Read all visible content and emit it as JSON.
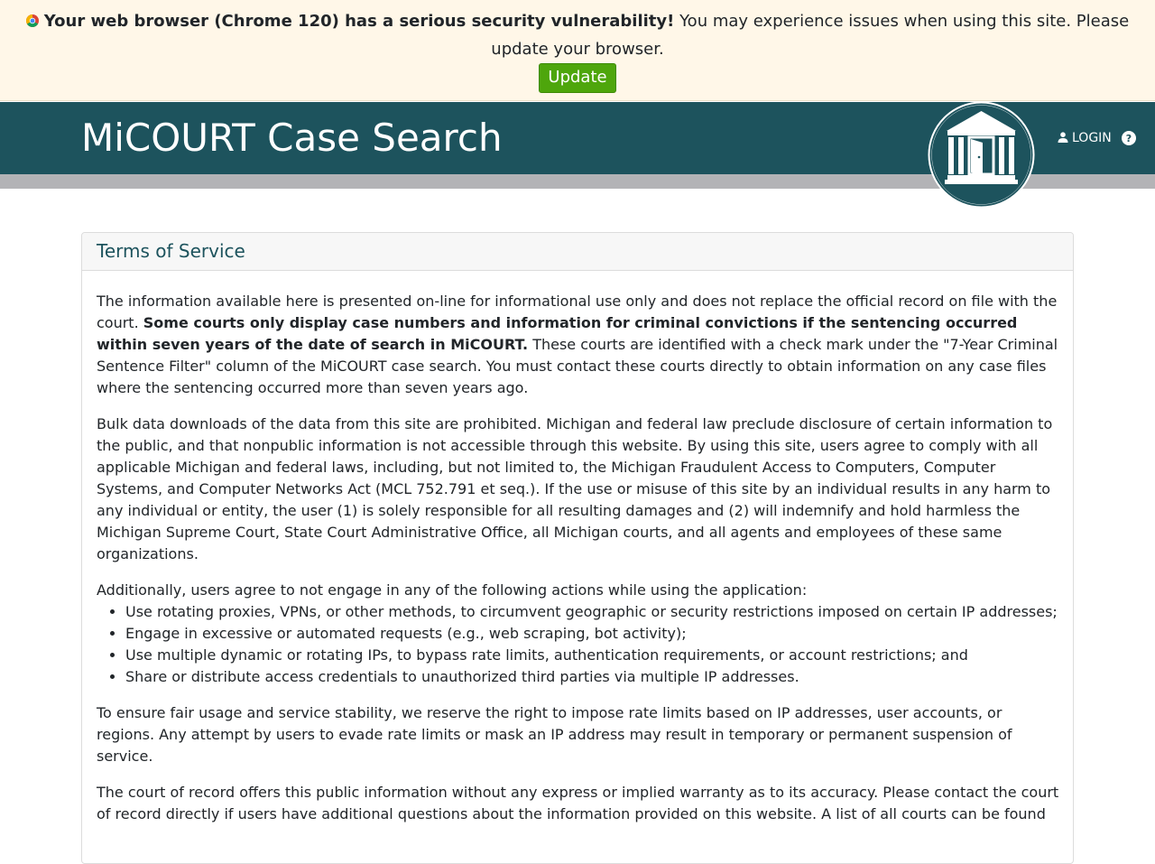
{
  "banner": {
    "warning_bold": "Your web browser (Chrome 120) has a serious security vulnerability!",
    "warning_rest": " You may experience issues when using this site. Please",
    "warning_line2": "update your browser.",
    "update_label": "Update",
    "icon": "chrome-icon"
  },
  "header": {
    "title": "MiCOURT Case Search",
    "login_label": "LOGIN",
    "logo_icon": "courthouse-logo",
    "help_icon": "help-icon",
    "colors": {
      "header_bg": "#1d535d",
      "accent_green": "#4ea60c"
    }
  },
  "terms": {
    "title": "Terms of Service",
    "p1_a": "The information available here is presented on-line for informational use only and does not replace the official record on file with the court. ",
    "p1_bold": "Some courts only display case numbers and information for criminal convictions if the sentencing occurred within seven years of the date of search in MiCOURT.",
    "p1_b": " These courts are identified with a check mark under the \"7-Year Criminal Sentence Filter\" column of the MiCOURT case search. You must contact these courts directly to obtain information on any case files where the sentencing occurred more than seven years ago.",
    "p2": "Bulk data downloads of the data from this site are prohibited. Michigan and federal law preclude disclosure of certain information to the public, and that nonpublic information is not accessible through this website. By using this site, users agree to comply with all applicable Michigan and federal laws, including, but not limited to, the Michigan Fraudulent Access to Computers, Computer Systems, and Computer Networks Act (MCL 752.791 et seq.). If the use or misuse of this site by an individual results in any harm to any individual or entity, the user (1) is solely responsible for all resulting damages and (2) will indemnify and hold harmless the Michigan Supreme Court, State Court Administrative Office, all Michigan courts, and all agents and employees of these same organizations.",
    "p3_intro": "Additionally, users agree to not engage in any of the following actions while using the application:",
    "bullets": [
      "Use rotating proxies, VPNs, or other methods, to circumvent geographic or security restrictions imposed on certain IP addresses;",
      "Engage in excessive or automated requests (e.g., web scraping, bot activity);",
      "Use multiple dynamic or rotating IPs, to bypass rate limits, authentication requirements, or account restrictions; and",
      "Share or distribute access credentials to unauthorized third parties via multiple IP addresses."
    ],
    "p4": "To ensure fair usage and service stability, we reserve the right to impose rate limits based on IP addresses, user accounts, or regions. Any attempt by users to evade rate limits or mask an IP address may result in temporary or permanent suspension of service.",
    "p5": "The court of record offers this public information without any express or implied warranty as to its accuracy. Please contact the court of record directly if users have additional questions about the information provided on this website. A list of all courts can be found"
  }
}
